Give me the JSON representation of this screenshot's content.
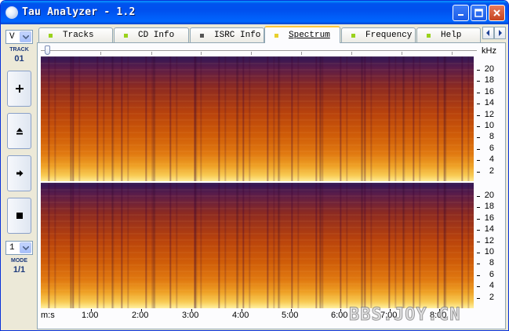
{
  "window": {
    "title": "Tau Analyzer - 1.2",
    "minimize_icon": "minimize-icon",
    "maximize_icon": "maximize-icon",
    "close_icon": "close-icon"
  },
  "left_panel": {
    "view_select": {
      "value": "V",
      "icon": "chevron-down-icon"
    },
    "track_label": "TRACK",
    "track_value": "01",
    "buttons": [
      {
        "name": "add-button",
        "icon": "plus-icon"
      },
      {
        "name": "eject-button",
        "icon": "eject-icon"
      },
      {
        "name": "play-button",
        "icon": "play-icon"
      },
      {
        "name": "stop-button",
        "icon": "stop-icon"
      }
    ],
    "mode_select": {
      "value": "1",
      "icon": "chevron-down-icon"
    },
    "mode_label": "MODE",
    "mode_value": "1/1"
  },
  "tabs": [
    {
      "label": "Tracks",
      "active": false
    },
    {
      "label": "CD Info",
      "active": false
    },
    {
      "label": "ISRC Info",
      "active": false
    },
    {
      "label": "Spectrum",
      "active": true
    },
    {
      "label": "Frequency",
      "active": false
    },
    {
      "label": "Help",
      "active": false
    }
  ],
  "tab_scroll": {
    "left_icon": "chevron-left-icon",
    "right_icon": "chevron-right-icon"
  },
  "spectrum": {
    "unit_label": "kHz",
    "freq_ticks": [
      "20",
      "18",
      "16",
      "14",
      "12",
      "10",
      "8",
      "6",
      "4",
      "2"
    ],
    "time_unit": "m:s",
    "time_ticks": [
      "1:00",
      "2:00",
      "3:00",
      "4:00",
      "5:00",
      "6:00",
      "7:00",
      "8:00"
    ],
    "colors": {
      "low": "#2f1655",
      "mid": "#b8420c",
      "high": "#fff0a0"
    }
  },
  "watermark": "BBS.JOY.CN"
}
